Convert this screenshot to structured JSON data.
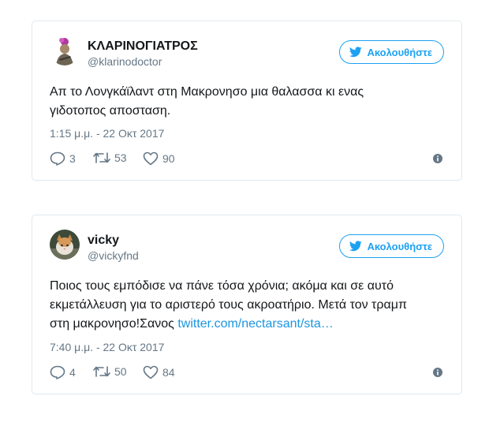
{
  "tweets": [
    {
      "display_name": "ΚΛΑΡΙΝΟΓΙΑΤΡΟΣ",
      "handle": "@klarinodoctor",
      "follow_label": "Ακολουθήστε",
      "text_line1": "Απ το Λονγκάϊλαντ στη Μακρονησο μια θαλασσα κι ενας",
      "text_line2": "γιδοτοπος αποσταση.",
      "time": "1:15 μ.μ. - 22 Οκτ 2017",
      "replies": "3",
      "retweets": "53",
      "likes": "90"
    },
    {
      "display_name": "vicky",
      "handle": "@vickyfnd",
      "follow_label": "Ακολουθήστε",
      "text_line1": "Ποιος τους εμπόδισε να πάνε τόσα χρόνια; ακόμα και σε αυτό",
      "text_line2": "εκμετάλλευση για το αριστερό τους ακροατήριο. Μετά τον τραμπ",
      "text_line3": "στη μακρονησο!Σανος ",
      "link": "twitter.com/nectarsant/sta…",
      "time": "7:40 μ.μ. - 22 Οκτ 2017",
      "replies": "4",
      "retweets": "50",
      "likes": "84"
    }
  ],
  "colors": {
    "accent": "#1da1f2",
    "link": "#1b95e0",
    "muted": "#657786",
    "border": "#e1e8ed"
  },
  "icons": [
    "twitter-bird-icon",
    "reply-icon",
    "retweet-icon",
    "like-icon",
    "info-icon"
  ]
}
